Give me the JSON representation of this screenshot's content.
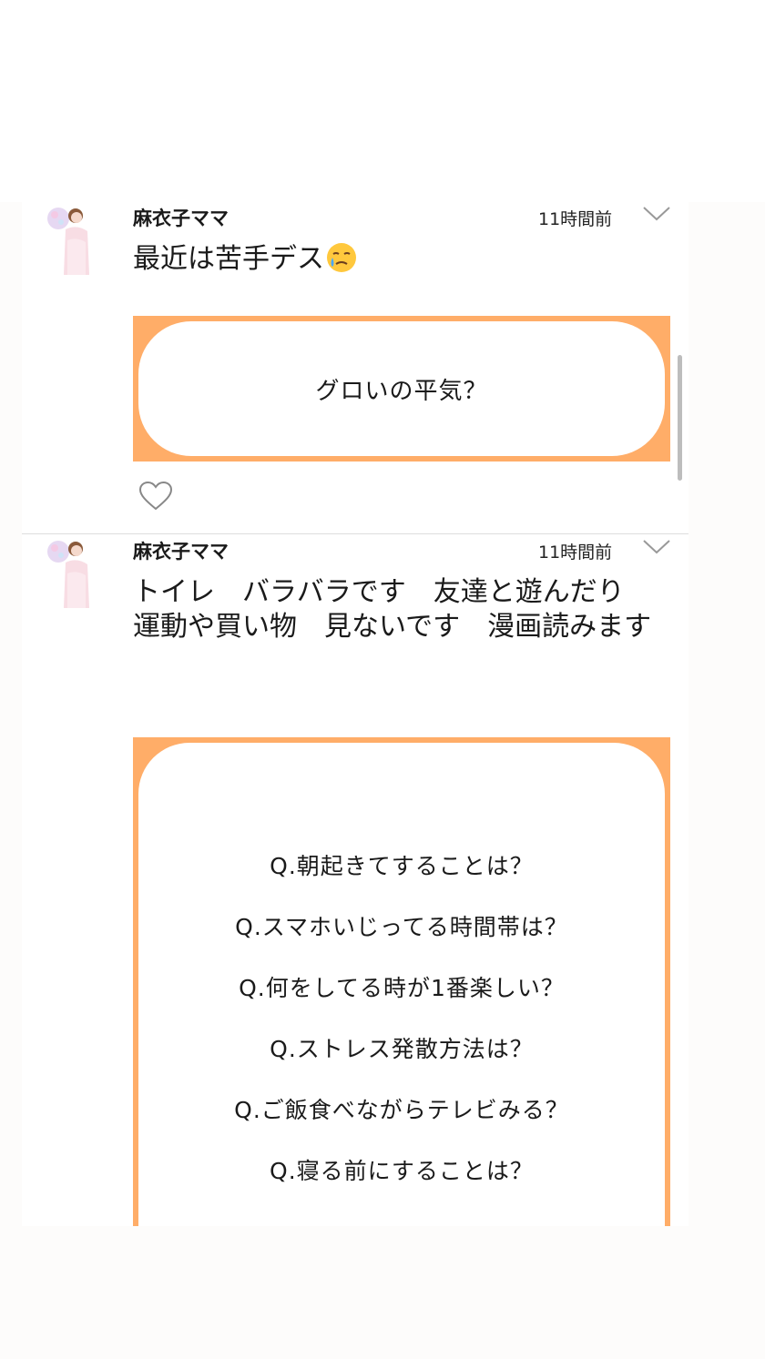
{
  "posts": [
    {
      "username": "麻衣子ママ",
      "time": "11時間前",
      "text": "最近は苦手デス",
      "emoji": "face-holding-back-tears",
      "card_lines": [
        "グロいの平気？"
      ]
    },
    {
      "username": "麻衣子ママ",
      "time": "11時間前",
      "text": "トイレ　バラバラです　友達と遊んだり　運動や買い物　見ないです　漫画読みます",
      "card_lines": [
        "Q.朝起きてすることは？",
        "Q.スマホいじってる時間帯は？",
        "Q.何をしてる時が1番楽しい？",
        "Q.ストレス発散方法は？",
        "Q.ご飯食べながらテレビみる？",
        "Q.寝る前にすることは？"
      ]
    }
  ],
  "colors": {
    "card_border": "#ffad68",
    "divider": "#dddddd",
    "scrollbar": "#bdbdbd"
  }
}
